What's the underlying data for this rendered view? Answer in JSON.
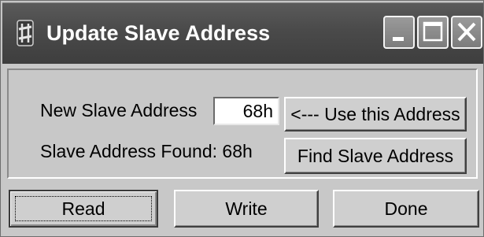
{
  "window": {
    "title": "Update Slave Address",
    "app_icon": "sharp-icon",
    "controls": {
      "minimize": "minimize-icon",
      "maximize": "maximize-icon",
      "close": "close-icon"
    }
  },
  "form": {
    "new_address_label": "New Slave Address",
    "new_address_value": "68h",
    "use_address_button": "<--- Use this Address",
    "found_label": "Slave Address Found: 68h",
    "find_button": "Find Slave Address"
  },
  "footer": {
    "read_button": "Read",
    "write_button": "Write",
    "done_button": "Done"
  },
  "colors": {
    "titlebar": "#4a4a4a",
    "face": "#c8c8c8",
    "title_text": "#ffffff"
  }
}
